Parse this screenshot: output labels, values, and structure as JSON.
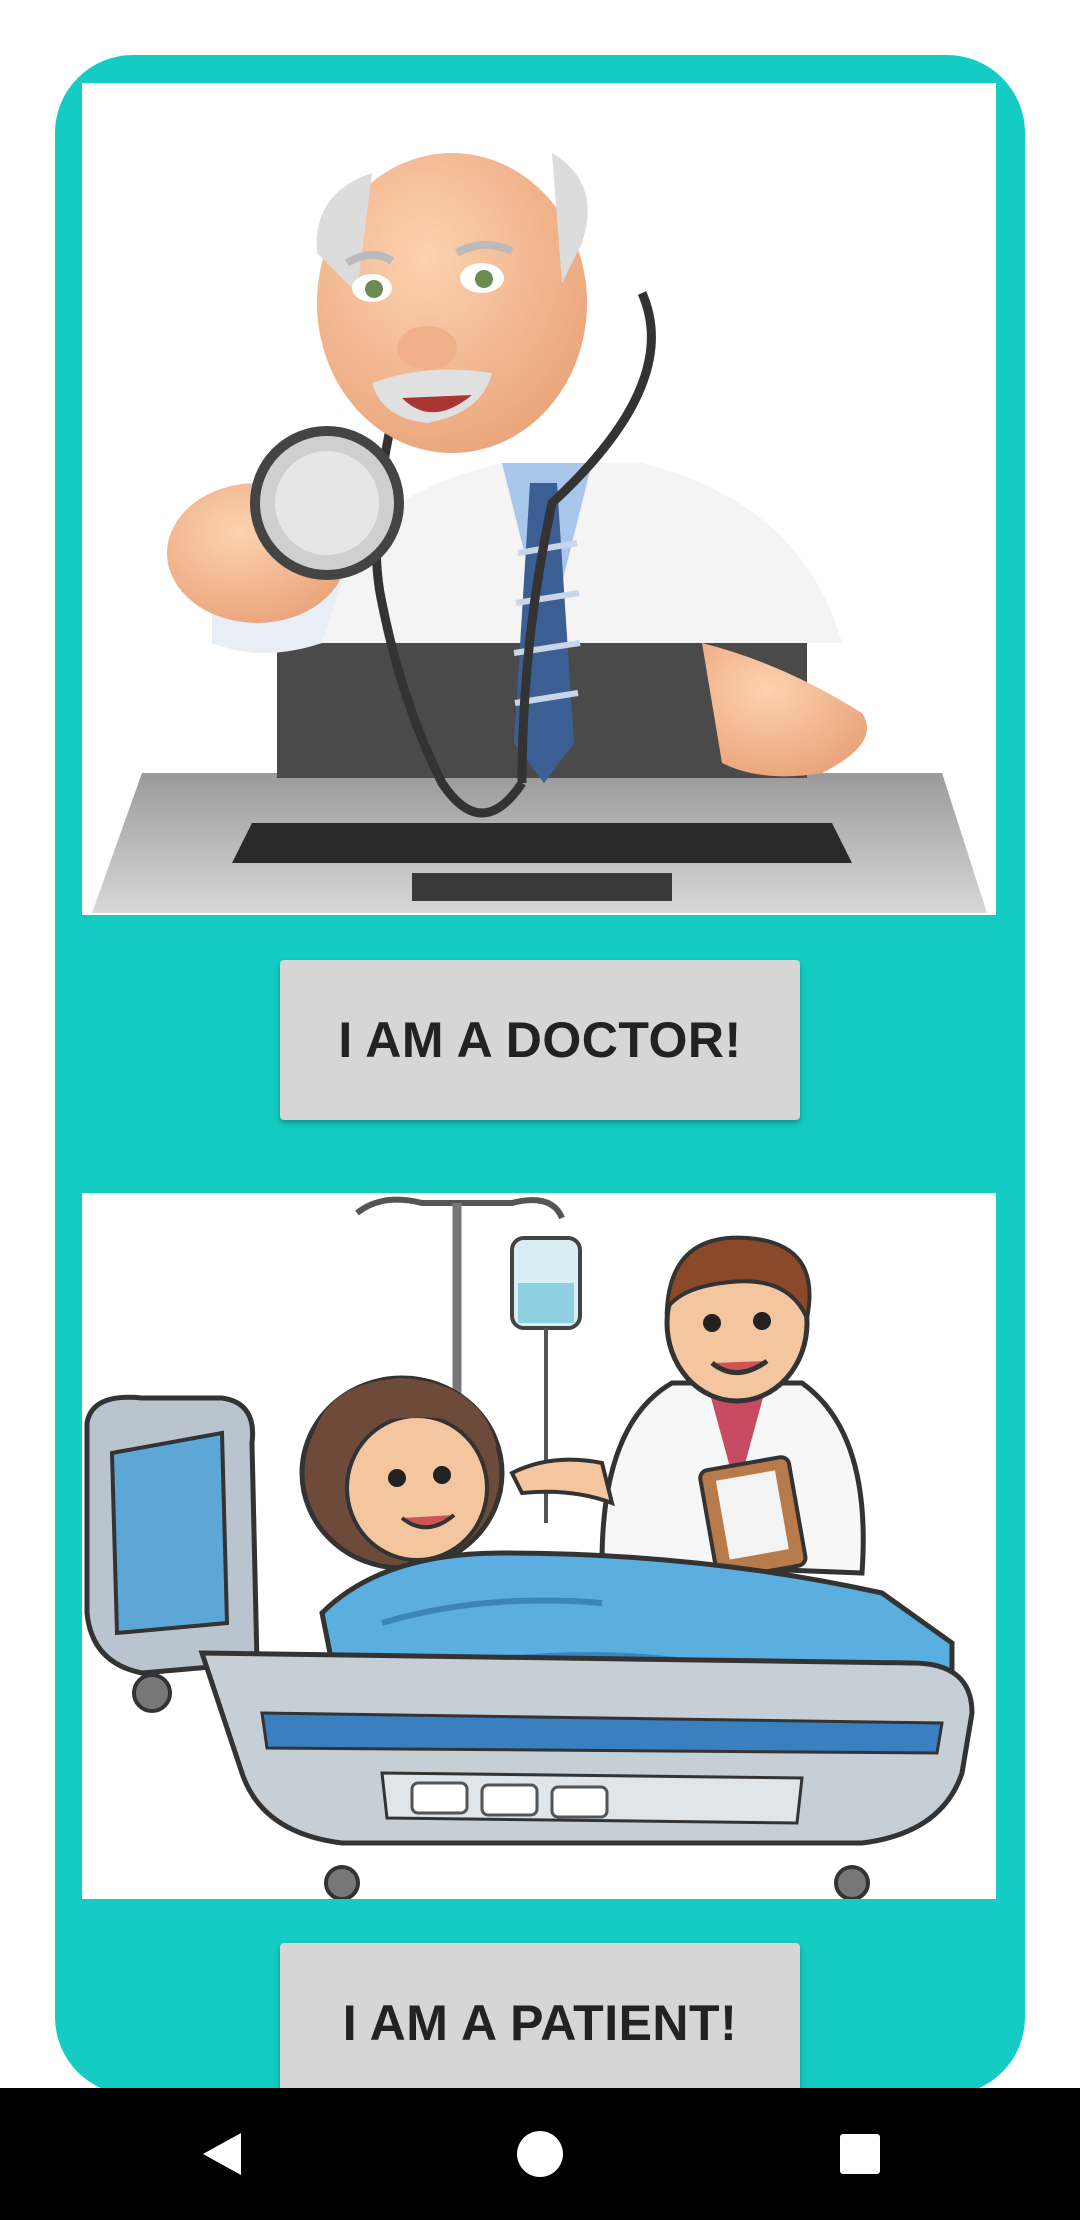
{
  "app": {
    "accent_color": "#14CCC3",
    "button_color": "#d6d6d6"
  },
  "roles": {
    "doctor": {
      "image_icon": "doctor-laptop-illustration",
      "button_label": "I AM A DOCTOR!"
    },
    "patient": {
      "image_icon": "patient-bed-illustration",
      "button_label": "I AM A PATIENT!"
    }
  },
  "navigation_bar": {
    "back_icon": "back-triangle-icon",
    "home_icon": "home-circle-icon",
    "recents_icon": "recents-square-icon"
  }
}
